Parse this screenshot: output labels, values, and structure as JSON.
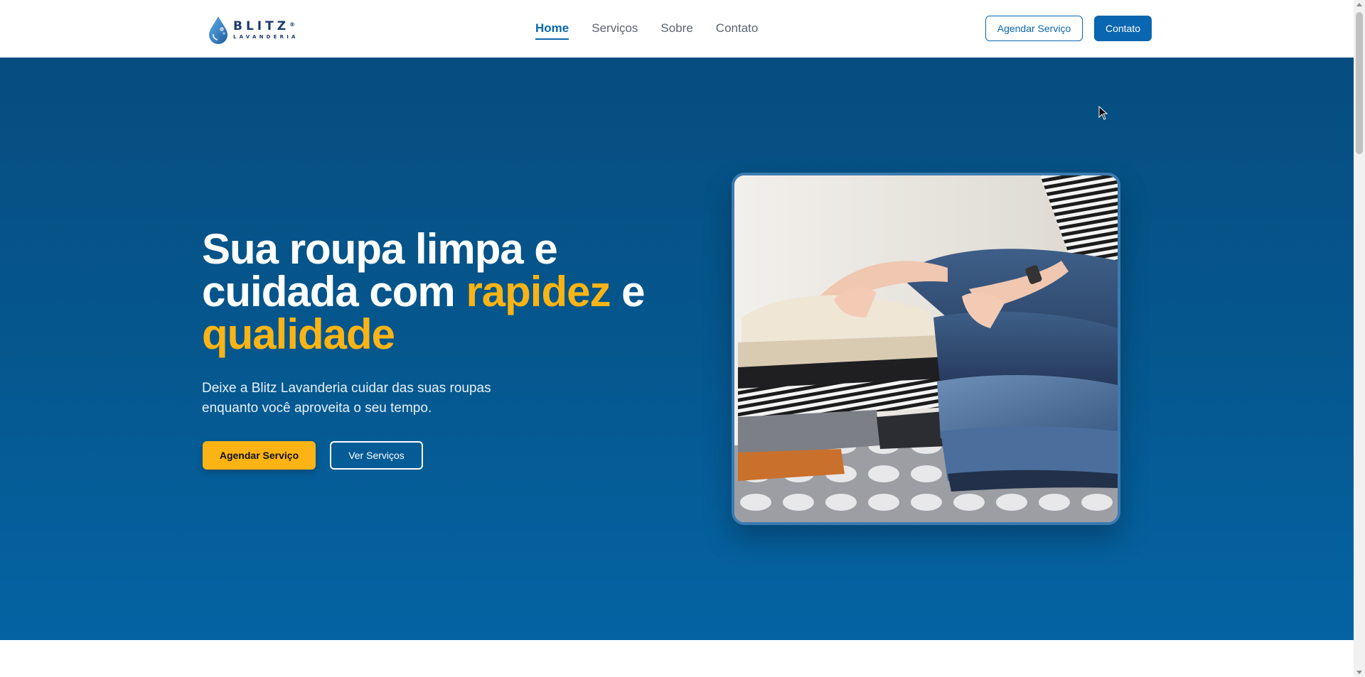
{
  "brand": {
    "name": "BLITZ",
    "registered": "®",
    "tagline": "LAVANDERIA",
    "primary_color": "#0a66b0",
    "accent_color": "#fbb414"
  },
  "nav": {
    "items": [
      {
        "label": "Home",
        "active": true
      },
      {
        "label": "Serviços",
        "active": false
      },
      {
        "label": "Sobre",
        "active": false
      },
      {
        "label": "Contato",
        "active": false
      }
    ]
  },
  "header_actions": {
    "schedule_label": "Agendar Serviço",
    "contact_label": "Contato"
  },
  "hero": {
    "title_part1": "Sua roupa limpa e cuidada com ",
    "title_accent1": "rapidez",
    "title_part2": " e ",
    "title_accent2": "qualidade",
    "subtitle": "Deixe a Blitz Lavanderia cuidar das suas roupas enquanto você aproveita o seu tempo.",
    "primary_button": "Agendar Serviço",
    "secondary_button": "Ver Serviços",
    "image_icon": "folded-clothes-photo"
  }
}
